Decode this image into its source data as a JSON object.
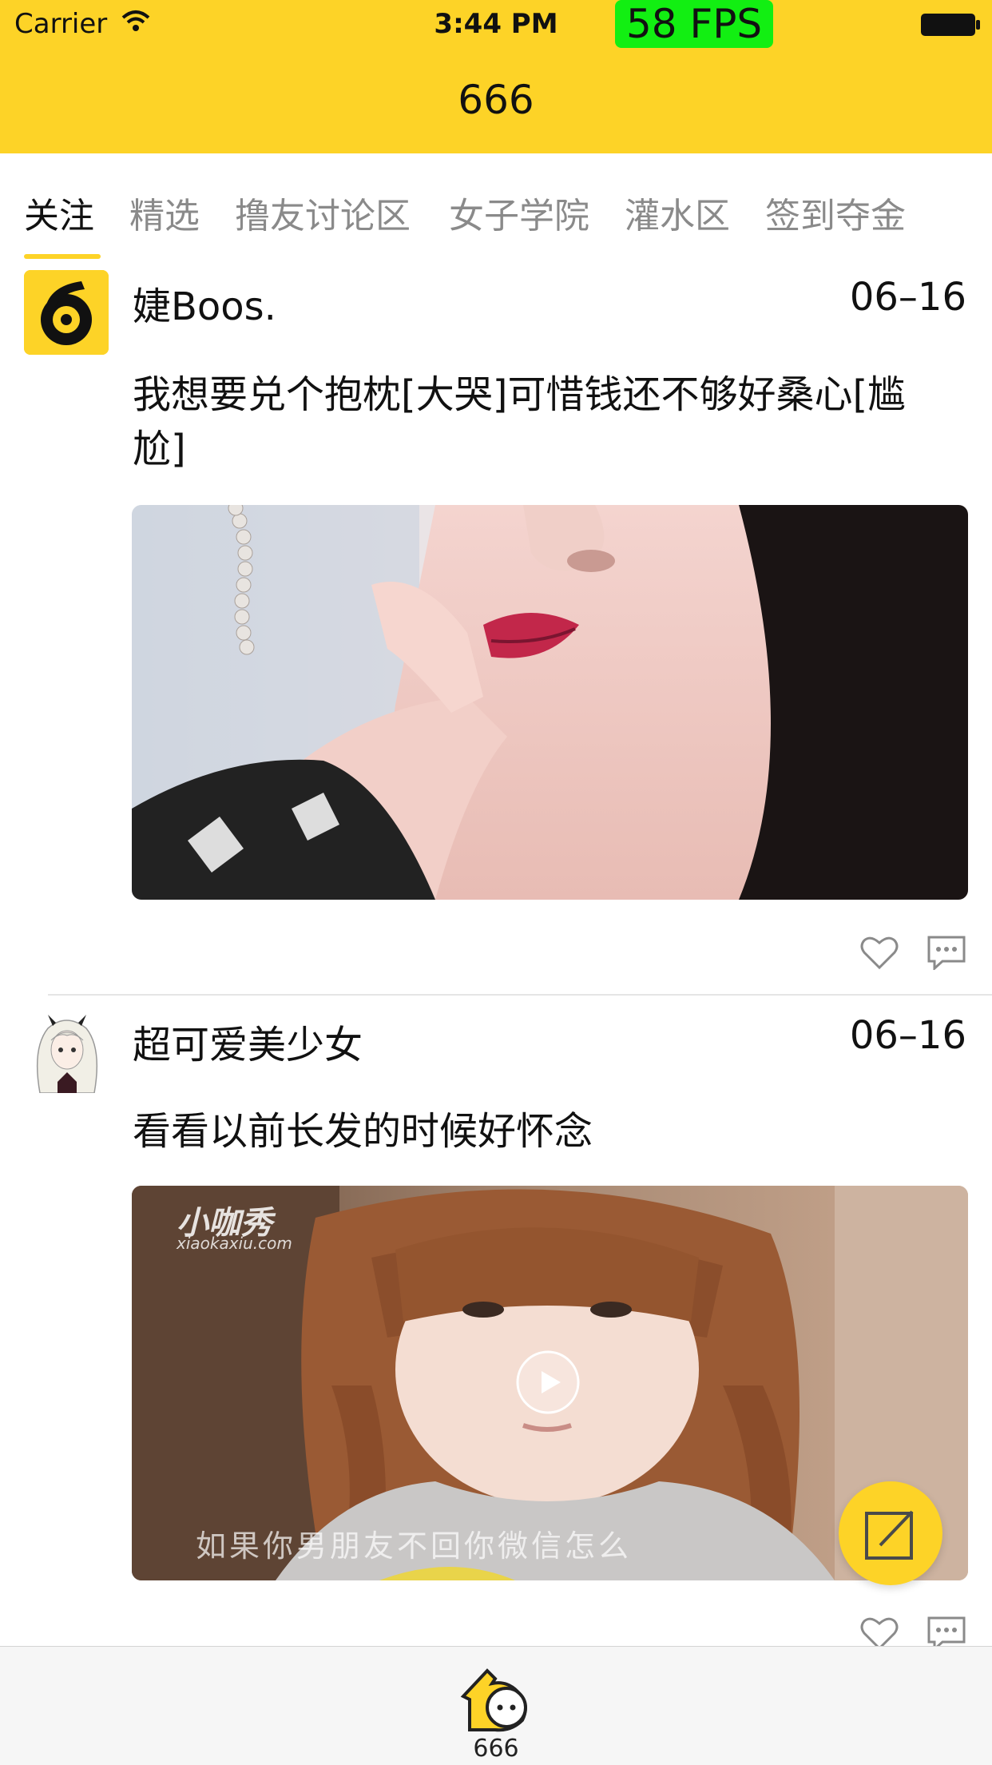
{
  "status_bar": {
    "carrier": "Carrier",
    "time": "3:44 PM",
    "fps": "58 FPS"
  },
  "nav": {
    "title": "666"
  },
  "tabs": [
    {
      "label": "关注",
      "active": true
    },
    {
      "label": "精选"
    },
    {
      "label": "撸友讨论区"
    },
    {
      "label": "女子学院"
    },
    {
      "label": "灌水区"
    },
    {
      "label": "签到夺金"
    }
  ],
  "posts": [
    {
      "username": "婕Boos.",
      "date": "06–16",
      "content": "我想要兑个抱枕[大哭]可惜钱还不够好桑心[尴尬]",
      "media_type": "image"
    },
    {
      "username": "超可爱美少女",
      "date": "06–16",
      "content": "看看以前长发的时候好怀念",
      "media_type": "video",
      "watermark": "小咖秀",
      "watermark_url": "xiaokaxiu.com",
      "subtitle": "如果你男朋友不回你微信怎么"
    }
  ],
  "tab_bar": {
    "label": "666"
  },
  "colors": {
    "accent": "#fdd327",
    "fps_badge": "#12ef12"
  },
  "icons": [
    "wifi-icon",
    "battery-icon",
    "heart-icon",
    "comment-icon",
    "play-icon",
    "compose-icon",
    "home-mascot-icon"
  ]
}
